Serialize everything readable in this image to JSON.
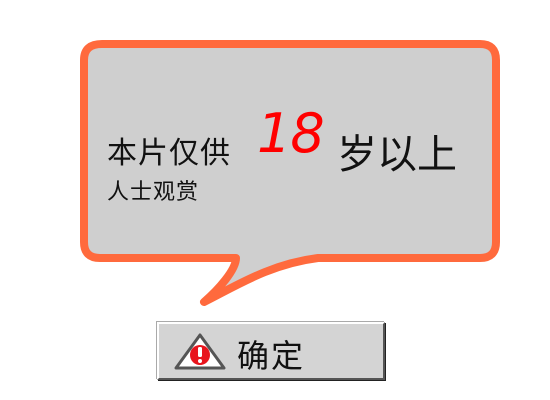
{
  "dialog": {
    "message_prefix": "本片仅供",
    "message_number": "18",
    "message_suffix": "岁以上",
    "message_line2": "人士观赏"
  },
  "ok_button": {
    "label": "确定",
    "icon": "warning-icon"
  },
  "colors": {
    "bubble_border": "#ff6a3d",
    "bubble_fill": "#cfcfcf",
    "highlight_number": "#ff0000",
    "button_face": "#d4d4d4",
    "icon_red": "#e8141c"
  }
}
